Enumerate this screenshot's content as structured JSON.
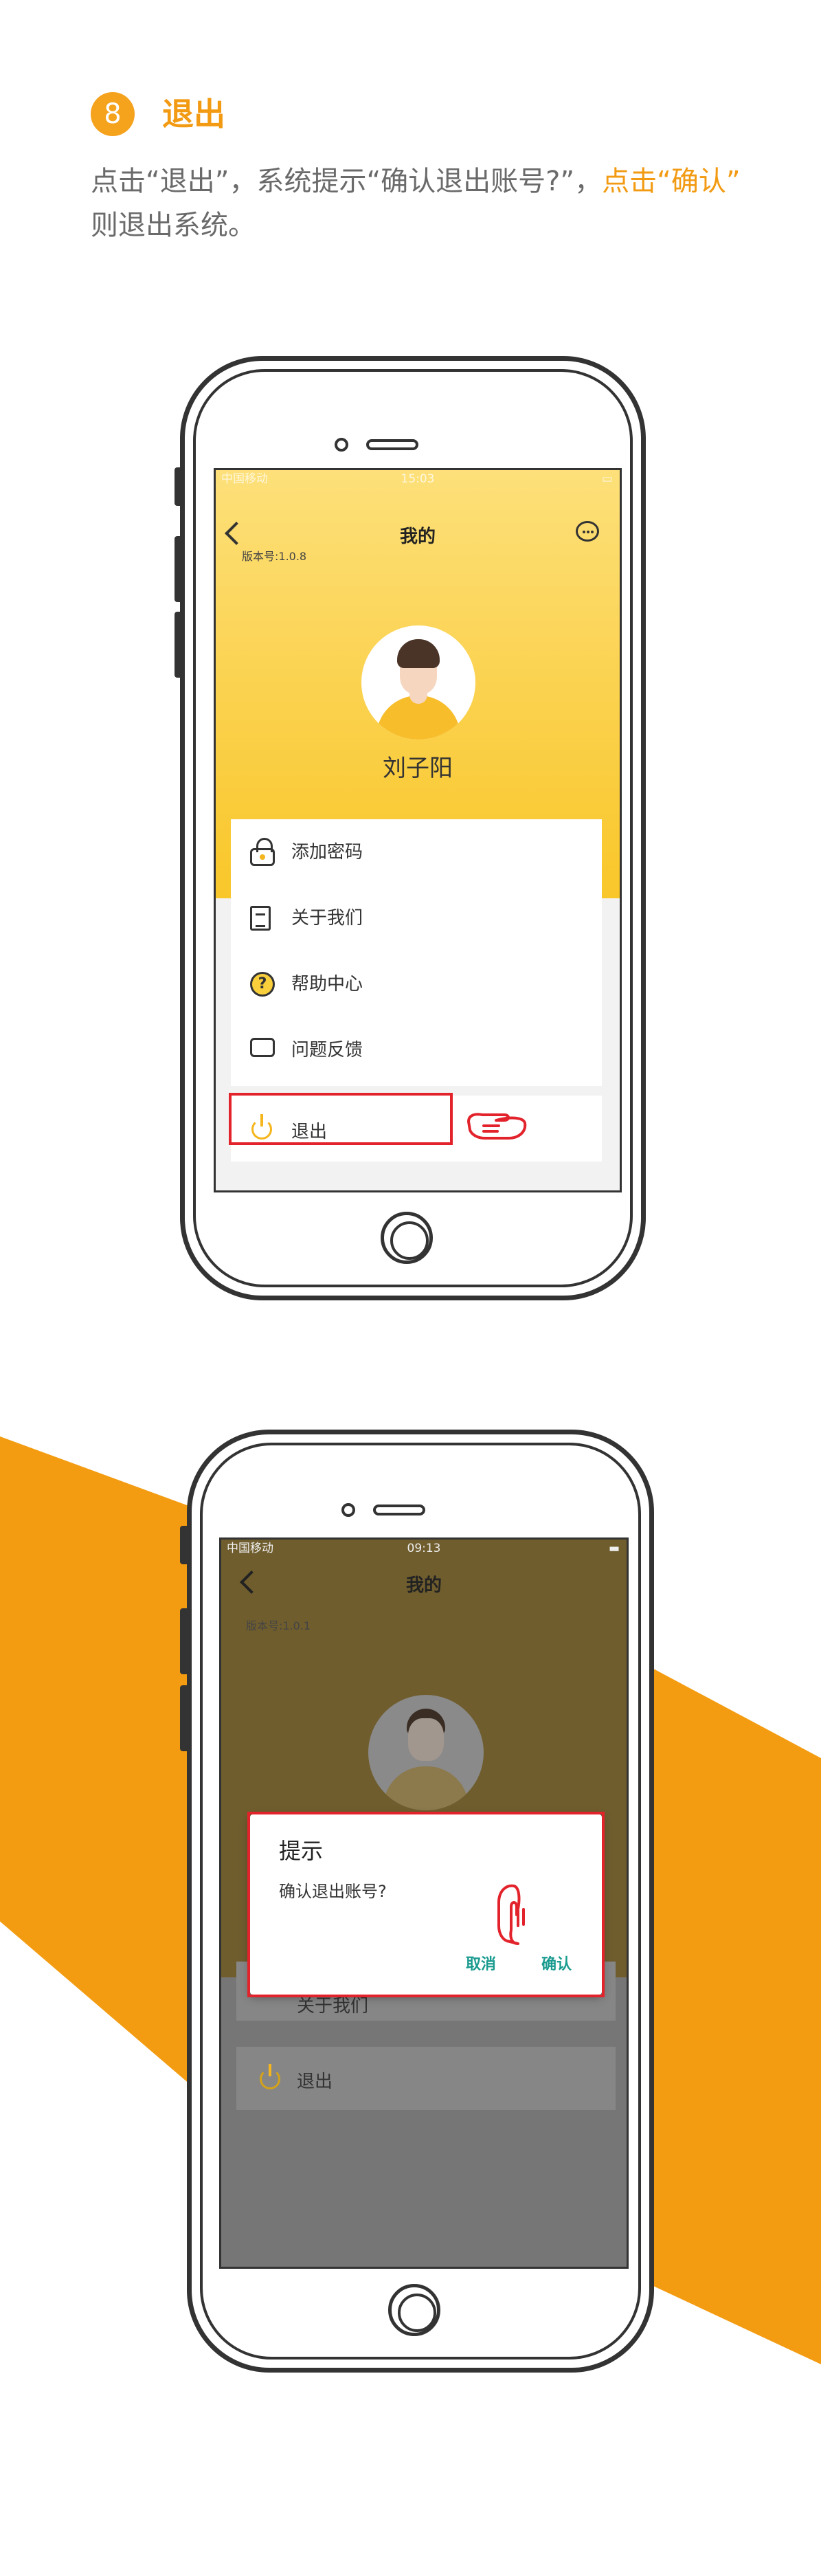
{
  "header": {
    "step_number": "8",
    "step_title": "退出",
    "desc_part1": "点击“退出”，系统提示“确认退出账号?”，",
    "desc_highlight": "点击“确认”",
    "desc_part2": "则退出系统。"
  },
  "screen1": {
    "status": {
      "carrier": "中国移动",
      "time": "15:03"
    },
    "nav_title": "我的",
    "version": "版本号:1.0.8",
    "user_name": "刘子阳",
    "menu_items": [
      {
        "label": "添加密码",
        "icon": "lock-icon"
      },
      {
        "label": "关于我们",
        "icon": "document-icon"
      },
      {
        "label": "帮助中心",
        "icon": "help-icon"
      },
      {
        "label": "问题反馈",
        "icon": "feedback-icon"
      }
    ],
    "logout_label": "退出"
  },
  "screen2": {
    "status": {
      "carrier": "中国移动",
      "time": "09:13"
    },
    "nav_title": "我的",
    "version": "版本号:1.0.1",
    "behind_menu_label": "关于我们",
    "logout_label": "退出",
    "dialog": {
      "title": "提示",
      "message": "确认退出账号?",
      "cancel_label": "取消",
      "confirm_label": "确认"
    }
  },
  "colors": {
    "accent_orange": "#f39c12",
    "highlight_red": "#e3232c",
    "dialog_button_teal": "#1a9b8f",
    "banner_yellow": "#fbd14c"
  }
}
